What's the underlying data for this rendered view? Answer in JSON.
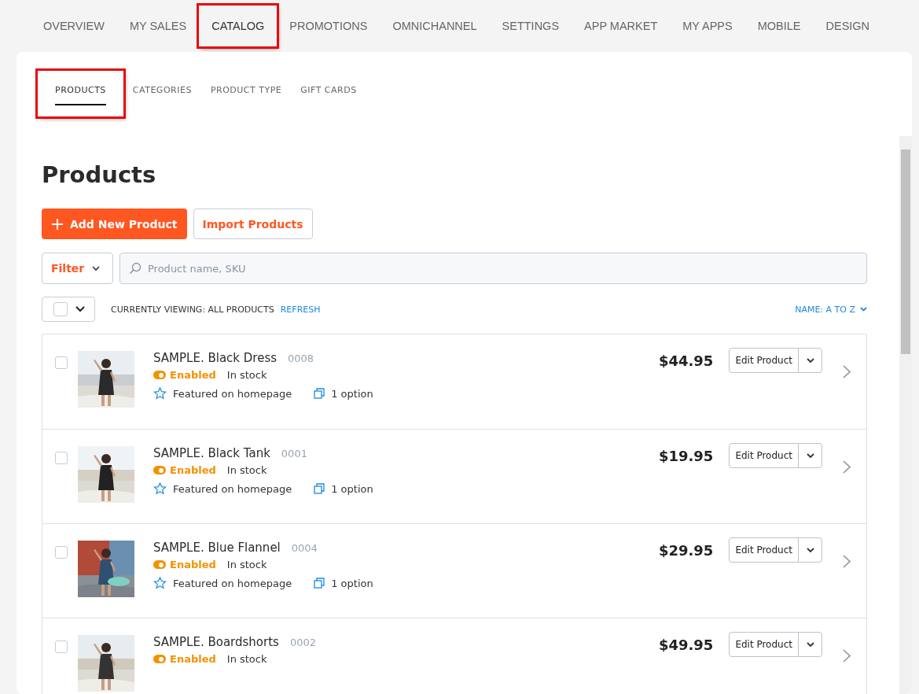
{
  "top_nav": [
    {
      "label": "OVERVIEW",
      "selected": false,
      "highlighted": false
    },
    {
      "label": "MY SALES",
      "selected": false,
      "highlighted": false
    },
    {
      "label": "CATALOG",
      "selected": true,
      "highlighted": true
    },
    {
      "label": "PROMOTIONS",
      "selected": false,
      "highlighted": false
    },
    {
      "label": "OMNICHANNEL",
      "selected": false,
      "highlighted": false
    },
    {
      "label": "SETTINGS",
      "selected": false,
      "highlighted": false
    },
    {
      "label": "APP MARKET",
      "selected": false,
      "highlighted": false
    },
    {
      "label": "MY APPS",
      "selected": false,
      "highlighted": false
    },
    {
      "label": "MOBILE",
      "selected": false,
      "highlighted": false
    },
    {
      "label": "DESIGN",
      "selected": false,
      "highlighted": false
    }
  ],
  "sub_tabs": [
    {
      "label": "PRODUCTS",
      "selected": true,
      "highlighted": true
    },
    {
      "label": "CATEGORIES",
      "selected": false,
      "highlighted": false
    },
    {
      "label": "PRODUCT TYPE",
      "selected": false,
      "highlighted": false
    },
    {
      "label": "GIFT CARDS",
      "selected": false,
      "highlighted": false
    }
  ],
  "page_title": "Products",
  "actions": {
    "add": "Add New Product",
    "import": "Import Products"
  },
  "filter": {
    "label": "Filter",
    "search_placeholder": "Product name, SKU"
  },
  "list_bar": {
    "checked": false,
    "viewing": "CURRENTLY VIEWING: ALL PRODUCTS",
    "refresh": "REFRESH",
    "sort": "NAME: A TO Z"
  },
  "products": [
    {
      "checked": false,
      "name": "SAMPLE. Black Dress",
      "sku": "0008",
      "enabled": true,
      "status": "Enabled",
      "stock": "In stock",
      "featured": "Featured on homepage",
      "options": "1 option",
      "price": "$44.95",
      "edit": "Edit Product"
    },
    {
      "checked": false,
      "name": "SAMPLE. Black Tank",
      "sku": "0001",
      "enabled": true,
      "status": "Enabled",
      "stock": "In stock",
      "featured": "Featured on homepage",
      "options": "1 option",
      "price": "$19.95",
      "edit": "Edit Product"
    },
    {
      "checked": false,
      "name": "SAMPLE. Blue Flannel",
      "sku": "0004",
      "enabled": true,
      "status": "Enabled",
      "stock": "In stock",
      "featured": "Featured on homepage",
      "options": "1 option",
      "price": "$29.95",
      "edit": "Edit Product"
    },
    {
      "checked": false,
      "name": "SAMPLE. Boardshorts",
      "sku": "0002",
      "enabled": true,
      "status": "Enabled",
      "stock": "In stock",
      "price": "$49.95",
      "edit": "Edit Product"
    }
  ]
}
